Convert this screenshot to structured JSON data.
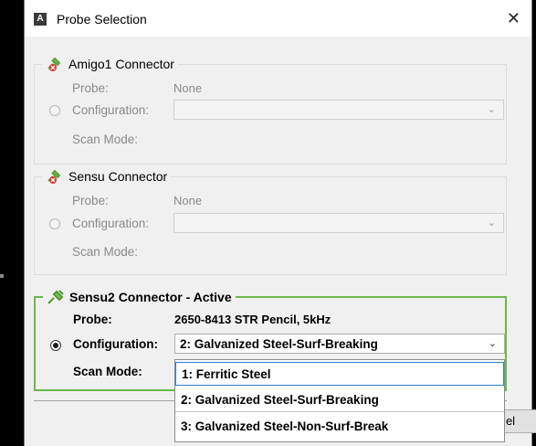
{
  "window": {
    "app_icon": "A",
    "title": "Probe Selection",
    "close_glyph": "✕"
  },
  "groups": [
    {
      "title": "Amigo1 Connector",
      "icon": "disconnected-plug-icon",
      "probe_label": "Probe:",
      "probe_value": "None",
      "config_label": "Configuration:",
      "config_value": "",
      "scan_label": "Scan Mode:",
      "enabled": false
    },
    {
      "title": "Sensu Connector",
      "icon": "disconnected-plug-icon",
      "probe_label": "Probe:",
      "probe_value": "None",
      "config_label": "Configuration:",
      "config_value": "",
      "scan_label": "Scan Mode:",
      "enabled": false
    },
    {
      "title": "Sensu2 Connector - Active",
      "icon": "connected-plug-icon",
      "probe_label": "Probe:",
      "probe_value": "2650-8413 STR Pencil, 5kHz",
      "config_label": "Configuration:",
      "config_value": "2: Galvanized Steel-Surf-Breaking",
      "scan_label": "Scan Mode:",
      "enabled": true
    }
  ],
  "dropdown": {
    "options": [
      "1: Ferritic Steel",
      "2: Galvanized Steel-Surf-Breaking",
      "3: Galvanized Steel-Non-Surf-Break"
    ],
    "highlighted_index": 0
  },
  "footer": {
    "button_label_visible": "el"
  },
  "colors": {
    "active_border": "#6bb84a",
    "disabled_text": "#8a8a8a",
    "highlight_border": "#2f7fd1"
  }
}
